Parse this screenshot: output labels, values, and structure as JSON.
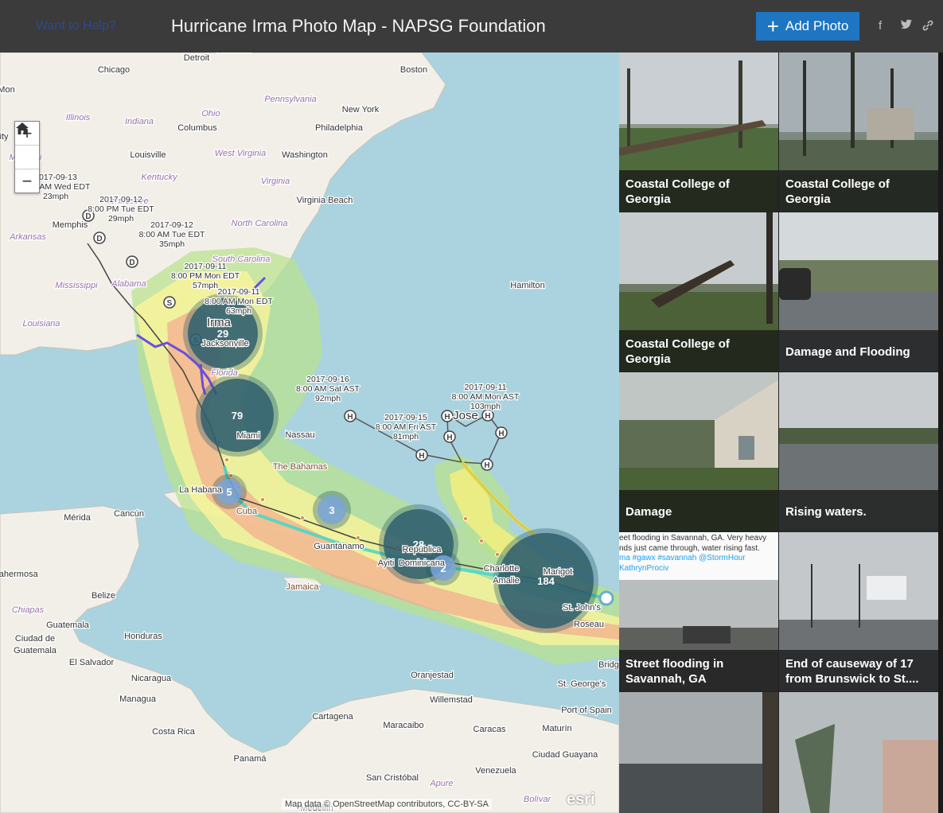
{
  "header": {
    "help_link": "Want to Help?",
    "title": "Hurricane Irma Photo Map - NAPSG Foundation",
    "add_photo_label": "Add Photo",
    "social": [
      "f",
      "t",
      "link"
    ]
  },
  "map": {
    "zoom_in": "+",
    "zoom_out": "−",
    "home": "⌂",
    "places": [
      {
        "id": "chicago",
        "label": "Chicago"
      },
      {
        "id": "detroit",
        "label": "Detroit"
      },
      {
        "id": "boston",
        "label": "Boston"
      },
      {
        "id": "newyork",
        "label": "New York"
      },
      {
        "id": "philadelphia",
        "label": "Philadelphia"
      },
      {
        "id": "pennsylvania",
        "label": "Pennsylvania"
      },
      {
        "id": "illinois",
        "label": "Illinois"
      },
      {
        "id": "indiana",
        "label": "Indiana"
      },
      {
        "id": "columbus",
        "label": "Columbus"
      },
      {
        "id": "ohio",
        "label": "Ohio"
      },
      {
        "id": "washington",
        "label": "Washington"
      },
      {
        "id": "louisville",
        "label": "Louisville"
      },
      {
        "id": "westvirginia",
        "label": "West Virginia"
      },
      {
        "id": "missouri",
        "label": "Missouri"
      },
      {
        "id": "kentucky",
        "label": "Kentucky"
      },
      {
        "id": "virginia",
        "label": "Virginia"
      },
      {
        "id": "virginiabeach",
        "label": "Virginia Beach"
      },
      {
        "id": "tennessee",
        "label": "Tennessee"
      },
      {
        "id": "northcarolina",
        "label": "North Carolina"
      },
      {
        "id": "memphis",
        "label": "Memphis"
      },
      {
        "id": "arkansas",
        "label": "Arkansas"
      },
      {
        "id": "southcarolina",
        "label": "South Carolina"
      },
      {
        "id": "mississippi",
        "label": "Mississippi"
      },
      {
        "id": "alabama",
        "label": "Alabama"
      },
      {
        "id": "louisiana",
        "label": "Louisiana"
      },
      {
        "id": "hamilton",
        "label": "Hamilton"
      },
      {
        "id": "florida",
        "label": "Florida"
      },
      {
        "id": "jacksonville",
        "label": "Jacksonville"
      },
      {
        "id": "miami",
        "label": "Miami"
      },
      {
        "id": "nassau",
        "label": "Nassau"
      },
      {
        "id": "bahamas",
        "label": "The Bahamas"
      },
      {
        "id": "lahabana",
        "label": "La Habana"
      },
      {
        "id": "cuba",
        "label": "Cuba"
      },
      {
        "id": "merida",
        "label": "Mérida"
      },
      {
        "id": "cancun",
        "label": "Cancún"
      },
      {
        "id": "guantanamo",
        "label": "Guantánamo"
      },
      {
        "id": "ayiti",
        "label": "Ayiti"
      },
      {
        "id": "republica",
        "label": "República"
      },
      {
        "id": "dominicana",
        "label": "Dominicana"
      },
      {
        "id": "jamaica",
        "label": "Jamaica"
      },
      {
        "id": "belize",
        "label": "Belize"
      },
      {
        "id": "chiapas",
        "label": "Chiapas"
      },
      {
        "id": "guatemala",
        "label": "Guatemala"
      },
      {
        "id": "honduras",
        "label": "Honduras"
      },
      {
        "id": "ciudadguatemala1",
        "label": "Ciudad de"
      },
      {
        "id": "ciudadguatemala2",
        "label": "Guatemala"
      },
      {
        "id": "elsalvador",
        "label": "El Salvador"
      },
      {
        "id": "nicaragua",
        "label": "Nicaragua"
      },
      {
        "id": "managua",
        "label": "Managua"
      },
      {
        "id": "costarica",
        "label": "Costa Rica"
      },
      {
        "id": "panama",
        "label": "Panamá"
      },
      {
        "id": "oranjestad",
        "label": "Oranjestad"
      },
      {
        "id": "willemstad",
        "label": "Willemstad"
      },
      {
        "id": "cartagena",
        "label": "Cartagena"
      },
      {
        "id": "maracaibo",
        "label": "Maracaibo"
      },
      {
        "id": "caracas",
        "label": "Caracas"
      },
      {
        "id": "maturin",
        "label": "Maturín"
      },
      {
        "id": "ciudadguayana",
        "label": "Ciudad Guayana"
      },
      {
        "id": "venezuela",
        "label": "Venezuela"
      },
      {
        "id": "sancristobal",
        "label": "San Cristóbal"
      },
      {
        "id": "apure",
        "label": "Apure"
      },
      {
        "id": "bolivar",
        "label": "Bolívar"
      },
      {
        "id": "medellin",
        "label": "Medellín"
      },
      {
        "id": "portofspain",
        "label": "Port of Spain"
      },
      {
        "id": "stgeorges",
        "label": "St. George's"
      },
      {
        "id": "roseau",
        "label": "Roseau"
      },
      {
        "id": "stjohns",
        "label": "St. John's"
      },
      {
        "id": "charlotte",
        "label": "Charlotte"
      },
      {
        "id": "amalie",
        "label": "Amalie"
      },
      {
        "id": "marigot",
        "label": "Marigot"
      },
      {
        "id": "bridgetown",
        "label": "Bridg"
      },
      {
        "id": "jose",
        "label": "Jose"
      },
      {
        "id": "irma",
        "label": "Irma"
      },
      {
        "id": "hermosa",
        "label": "lahermosa"
      },
      {
        "id": "ity",
        "label": "ity"
      },
      {
        "id": "mon",
        "label": "Mon"
      },
      {
        "id": "hamilton2",
        "label": "Hamilton"
      }
    ],
    "track_labels": [
      {
        "id": "t1",
        "lines": [
          "2017-09-13",
          "8:00 AM Wed EDT",
          "23mph"
        ]
      },
      {
        "id": "t2",
        "lines": [
          "2017-09-12",
          "8:00 PM Tue EDT",
          "29mph"
        ]
      },
      {
        "id": "t3",
        "lines": [
          "2017-09-12",
          "8:00 AM Tue EDT",
          "35mph"
        ]
      },
      {
        "id": "t4",
        "lines": [
          "2017-09-11",
          "8:00 PM Mon EDT",
          "57mph"
        ]
      },
      {
        "id": "t5",
        "lines": [
          "2017-09-11",
          "8:00 AM Mon EDT",
          "63mph"
        ]
      },
      {
        "id": "t6",
        "lines": [
          "2017-09-16",
          "8:00 AM Sat AST",
          "92mph"
        ]
      },
      {
        "id": "t7",
        "lines": [
          "2017-09-15",
          "8:00 AM Fri AST",
          "81mph"
        ]
      },
      {
        "id": "t8",
        "lines": [
          "2017-09-11",
          "8:00 AM Mon AST",
          "103mph"
        ]
      }
    ],
    "clusters": [
      {
        "id": "c29",
        "count": "29"
      },
      {
        "id": "c79",
        "count": "79"
      },
      {
        "id": "c5",
        "count": "5"
      },
      {
        "id": "c3",
        "count": "3"
      },
      {
        "id": "c28",
        "count": "28"
      },
      {
        "id": "c2",
        "count": "2"
      },
      {
        "id": "c184",
        "count": "184"
      }
    ],
    "attribution": "Map data © OpenStreetMap contributors, CC-BY-SA",
    "esri": "esri"
  },
  "gallery": {
    "items": [
      {
        "caption": "Coastal College of Georgia"
      },
      {
        "caption": "Coastal College of Georgia"
      },
      {
        "caption": "Coastal College of Georgia"
      },
      {
        "caption": "Damage and Flooding"
      },
      {
        "caption": "Damage"
      },
      {
        "caption": "Rising waters."
      },
      {
        "caption": "Street flooding in Savannah, GA"
      },
      {
        "caption": "End of causeway of 17 from Brunswick to St...."
      },
      {
        "caption": ""
      },
      {
        "caption": ""
      }
    ],
    "tweet_overlay": [
      "eet flooding in Savannah, GA. Very heavy",
      "nds just came through, water rising fast.",
      "ma #gawx #savannah @StormHour",
      "KathrynProciv"
    ]
  }
}
